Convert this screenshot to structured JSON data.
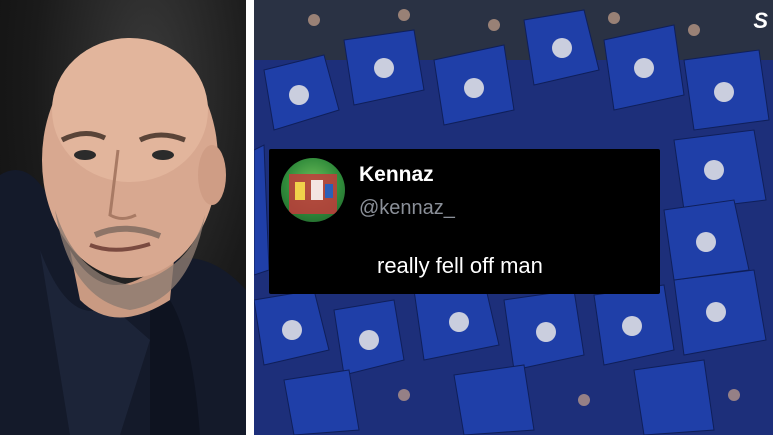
{
  "logo": {
    "text": "S"
  },
  "tweet": {
    "display_name": "Kennaz",
    "handle": "@kennaz_",
    "text": "really fell off man"
  },
  "colors": {
    "crowd_blue": "#1d2f7a",
    "flag_blue": "#1f3fa8",
    "card_bg": "#000000",
    "handle_grey": "#8b9099"
  },
  "icons": [
    "avatar-image",
    "crest-image"
  ]
}
